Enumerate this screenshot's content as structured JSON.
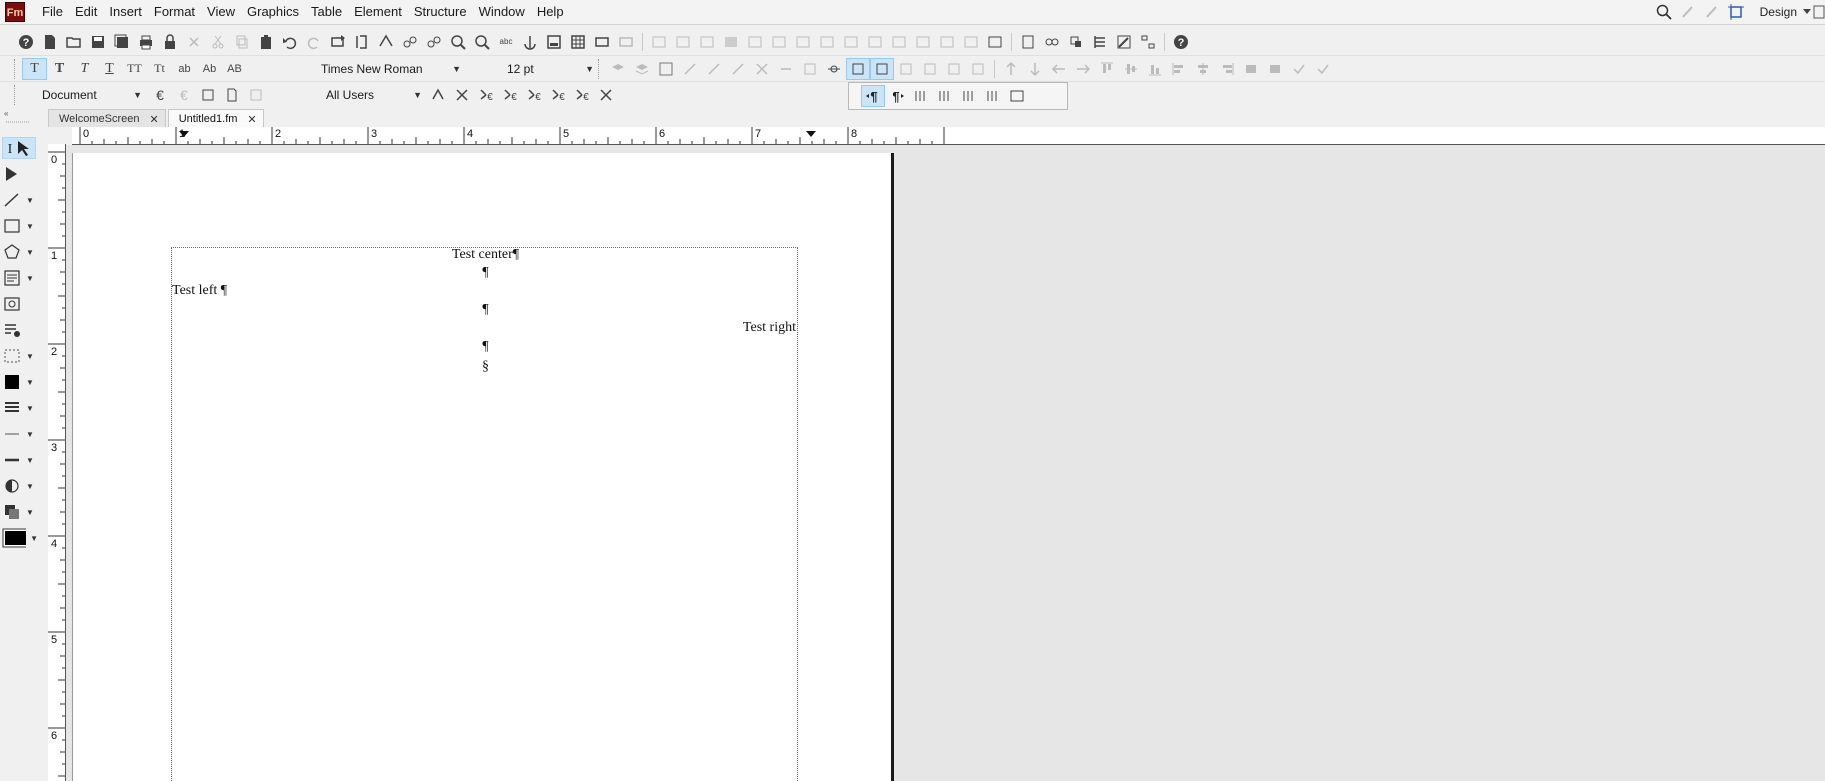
{
  "app": {
    "logo": "Fm"
  },
  "menu": [
    "File",
    "Edit",
    "Insert",
    "Format",
    "View",
    "Graphics",
    "Table",
    "Element",
    "Structure",
    "Window",
    "Help"
  ],
  "workspace": {
    "label": "Design"
  },
  "format_bar": {
    "style_buttons": [
      "T",
      "T",
      "T",
      "T",
      "TT",
      "Tt",
      "ab",
      "Ab",
      "AB"
    ],
    "font_name": "Times New Roman",
    "font_size": "12 pt"
  },
  "context_bar": {
    "view_mode": "Document",
    "users": "All Users"
  },
  "tabs": [
    {
      "label": "WelcomeScreen",
      "active": false
    },
    {
      "label": "Untitled1.fm",
      "active": true
    }
  ],
  "ruler": {
    "horizontal": [
      "0",
      "1",
      "2",
      "3",
      "4",
      "5",
      "6",
      "7",
      "8"
    ],
    "vertical": [
      "0",
      "1",
      "2",
      "3",
      "4",
      "5",
      "6"
    ]
  },
  "document": {
    "center_line": "Test center¶",
    "pilcrow_1": "¶",
    "left_line": "Test left ¶",
    "pilcrow_2": "¶",
    "right_line": "Test right",
    "pilcrow_3": "¶",
    "end_flow": "§"
  },
  "colors": {
    "accent": "#cce4f7",
    "logo_bg": "#7a0e0e",
    "canvas_bg": "#e6e6e6"
  }
}
